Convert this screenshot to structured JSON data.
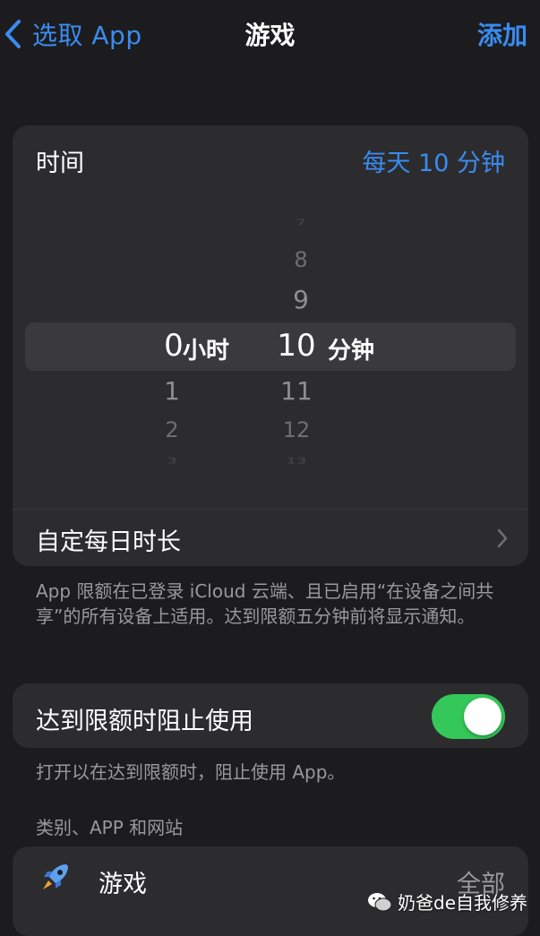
{
  "nav": {
    "back_label": "选取 App",
    "title": "游戏",
    "add_label": "添加"
  },
  "time_card": {
    "label": "时间",
    "value": "每天 10 分钟",
    "picker": {
      "hours_visible": [
        "0",
        "1",
        "2",
        "3"
      ],
      "hours_selected": "0",
      "hours_unit": "小时",
      "minutes_visible": [
        "7",
        "8",
        "9",
        "10",
        "11",
        "12",
        "13"
      ],
      "minutes_selected": "10",
      "minutes_unit": "分钟"
    },
    "custom_label": "自定每日时长"
  },
  "footnote_limit": "App 限额在已登录 iCloud 云端、且已启用“在设备之间共享”的所有设备上适用。达到限额五分钟前将显示通知。",
  "block_card": {
    "label": "达到限额时阻止使用",
    "toggle_on": true
  },
  "footnote_block": "打开以在达到限额时，阻止使用 App。",
  "section_header": "类别、APP 和网站",
  "games_row": {
    "label": "游戏",
    "value": "全部"
  },
  "watermark": "奶爸de自我修养",
  "colors": {
    "accent": "#3a8cf0",
    "toggle_on": "#34c759",
    "background": "#1c1c1e",
    "card": "#2c2c2e"
  }
}
